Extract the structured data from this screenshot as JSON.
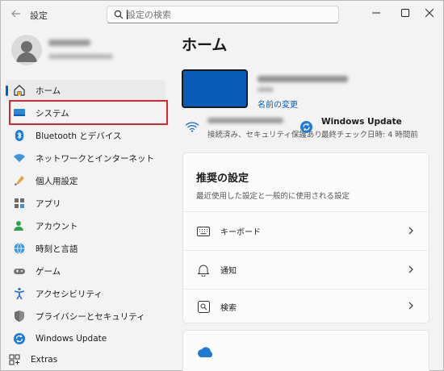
{
  "window": {
    "title": "設定",
    "back_icon": "back-arrow-icon",
    "controls": {
      "minimize": "—",
      "maximize": "☐",
      "close": "✕"
    }
  },
  "search": {
    "placeholder": "設定の検索",
    "value": ""
  },
  "profile": {
    "avatar_icon": "user-avatar-icon"
  },
  "sidebar": {
    "accent_color": "#005fb8",
    "highlight_color": "#d9272e",
    "items": [
      {
        "label": "ホーム",
        "icon": "home-icon",
        "selected": true
      },
      {
        "label": "システム",
        "icon": "system-icon",
        "highlighted": true
      },
      {
        "label": "Bluetooth とデバイス",
        "icon": "bluetooth-icon"
      },
      {
        "label": "ネットワークとインターネット",
        "icon": "network-icon"
      },
      {
        "label": "個人用設定",
        "icon": "personalization-icon"
      },
      {
        "label": "アプリ",
        "icon": "apps-icon"
      },
      {
        "label": "アカウント",
        "icon": "account-icon"
      },
      {
        "label": "時刻と言語",
        "icon": "time-language-icon"
      },
      {
        "label": "ゲーム",
        "icon": "gaming-icon"
      },
      {
        "label": "アクセシビリティ",
        "icon": "accessibility-icon"
      },
      {
        "label": "プライバシーとセキュリティ",
        "icon": "privacy-shield-icon"
      },
      {
        "label": "Windows Update",
        "icon": "windows-update-icon"
      }
    ],
    "extras": {
      "label": "Extras",
      "icon": "extras-icon"
    }
  },
  "main": {
    "title": "ホーム",
    "device": {
      "rename_link": "名前の変更",
      "accent_color": "#0a5cb8"
    },
    "network": {
      "status": "接続済み、セキュリティ保護あり"
    },
    "windows_update": {
      "title": "Windows Update",
      "status": "最終チェック日時: 4 時間前"
    },
    "recommended": {
      "title": "推奨の設定",
      "subtitle": "最近使用した設定と一般的に使用される設定",
      "rows": [
        {
          "label": "キーボード",
          "icon": "keyboard-icon"
        },
        {
          "label": "通知",
          "icon": "notification-bell-icon"
        },
        {
          "label": "検索",
          "icon": "search-settings-icon"
        }
      ]
    },
    "onedrive": {
      "icon": "onedrive-cloud-icon"
    }
  }
}
